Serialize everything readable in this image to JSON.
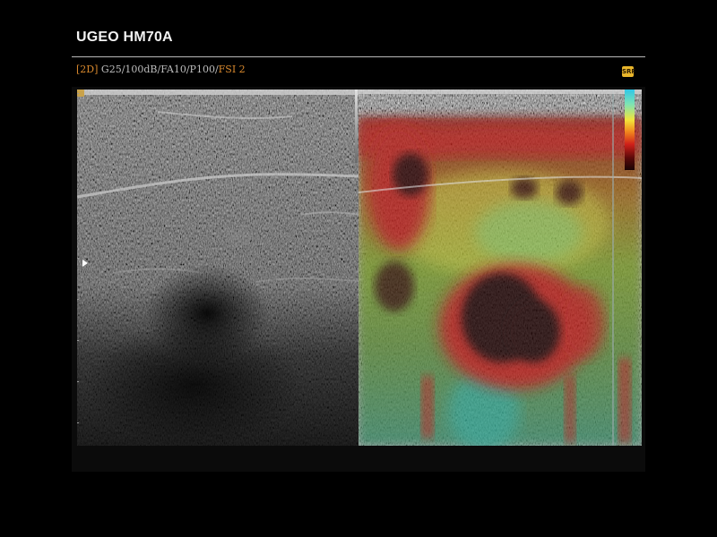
{
  "header": {
    "title": "UGEO HM70A"
  },
  "params": {
    "mode": "[2D]",
    "settings": "G25/100dB/FA10/P100/",
    "fsi": "FSI 2"
  },
  "icons": {
    "srf": "SRF",
    "srf_icon_name": "srf-indicator-icon",
    "focus_icon_name": "focus-arrow-icon"
  },
  "colors": {
    "accent": "#d9892d",
    "background": "#000000",
    "text": "#f2f2f2"
  }
}
